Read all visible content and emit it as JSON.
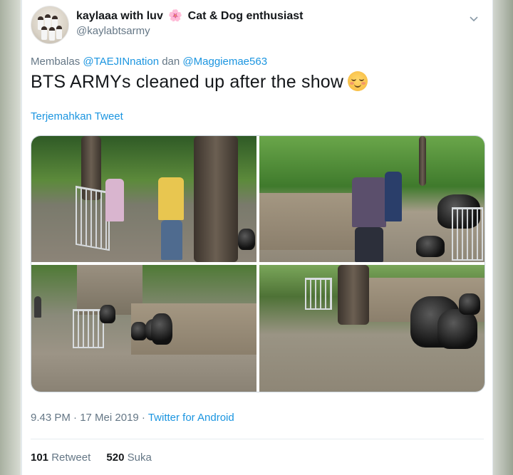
{
  "tweet": {
    "author": {
      "display_name": "kaylaaa with luv",
      "display_name_emoji": "🌸",
      "display_name_suffix": "Cat & Dog enthusiast",
      "handle": "@kaylabtsarmy"
    },
    "reply": {
      "prefix": "Membalas",
      "mention_1": "@TAEJINnation",
      "joiner": "dan",
      "mention_2": "@Maggiemae563"
    },
    "text": "BTS ARMYs cleaned up after the show",
    "emoji": "smiling-face-with-blush-emoji",
    "translate_label": "Terjemahkan Tweet",
    "media": [
      {
        "name": "photo-1",
        "description_icon": "photo"
      },
      {
        "name": "photo-2",
        "description_icon": "photo"
      },
      {
        "name": "photo-3",
        "description_icon": "photo"
      },
      {
        "name": "photo-4",
        "description_icon": "photo"
      }
    ],
    "timestamp": "9.43 PM · 17 Mei 2019 ·",
    "source": "Twitter for Android",
    "stats": {
      "retweets_count": "101",
      "retweets_label": "Retweet",
      "likes_count": "520",
      "likes_label": "Suka"
    }
  },
  "colors": {
    "link": "#1b95e0",
    "secondary_text": "#657786",
    "primary_text": "#14171a"
  }
}
